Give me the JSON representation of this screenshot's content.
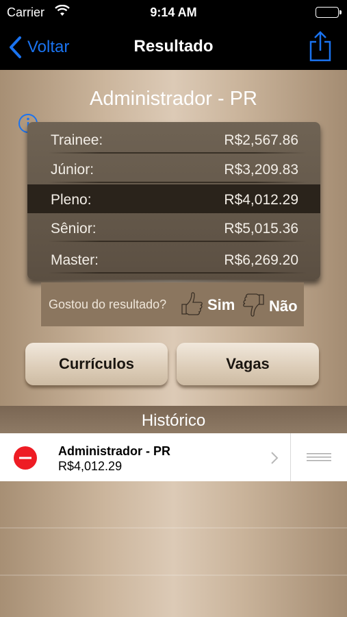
{
  "status": {
    "carrier": "Carrier",
    "time": "9:14 AM"
  },
  "nav": {
    "back_label": "Voltar",
    "title": "Resultado"
  },
  "result": {
    "heading": "Administrador - PR",
    "rows": [
      {
        "label": "Trainee:",
        "value": "R$2,567.86"
      },
      {
        "label": "Júnior:",
        "value": "R$3,209.83"
      },
      {
        "label": "Pleno:",
        "value": "R$4,012.29"
      },
      {
        "label": "Sênior:",
        "value": "R$5,015.36"
      },
      {
        "label": "Master:",
        "value": "R$6,269.20"
      }
    ],
    "selected_row": "Pleno:"
  },
  "feedback": {
    "question": "Gostou do resultado?",
    "yes": "Sim",
    "no": "Não"
  },
  "actions": {
    "curriculos": "Currículos",
    "vagas": "Vagas"
  },
  "history": {
    "header": "Histórico",
    "items": [
      {
        "title": "Administrador - PR",
        "value": "R$4,012.29"
      }
    ]
  },
  "colors": {
    "accent": "#1a73f0",
    "delete": "#ee1c24",
    "selected_row": "#2a231b"
  }
}
